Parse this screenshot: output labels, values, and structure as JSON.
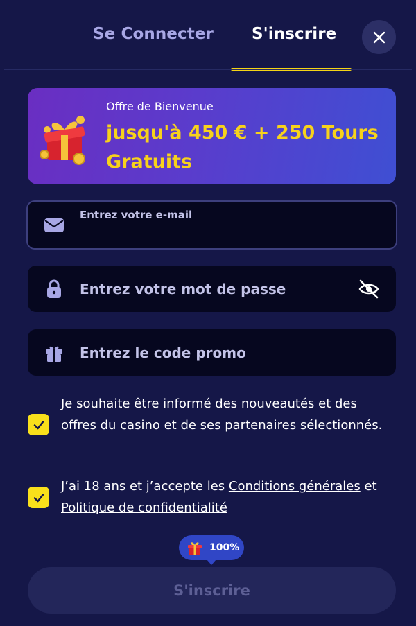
{
  "tabs": {
    "login_label": "Se Connecter",
    "register_label": "S'inscrire"
  },
  "banner": {
    "subtitle": "Offre de Bienvenue",
    "offer": "jusqu'à 450 € + 250 Tours Gratuits"
  },
  "form": {
    "email_label": "Entrez votre e-mail",
    "password_placeholder": "Entrez votre mot de passe",
    "promo_placeholder": "Entrez le code promo"
  },
  "consents": {
    "newsletter_text": "Je souhaite être informé des nouveautés et des offres du casino et de ses partenaires sélectionnés.",
    "terms_prefix": "J’ai 18 ans et j’accepte les ",
    "terms_link": "Conditions générales",
    "terms_middle": " et ",
    "privacy_link": "Politique de confidentialité"
  },
  "badge": {
    "label": "100%"
  },
  "submit_label": "S'inscrire",
  "colors": {
    "background": "#151748",
    "accent": "#f5d416",
    "input_bg": "#06071f",
    "muted_text": "#a8a7e5"
  },
  "icons": {
    "close": "close-icon",
    "email": "envelope-icon",
    "password": "lock-icon",
    "visibility": "eye-slash-icon",
    "promo": "gift-icon",
    "check": "checkmark-icon"
  }
}
